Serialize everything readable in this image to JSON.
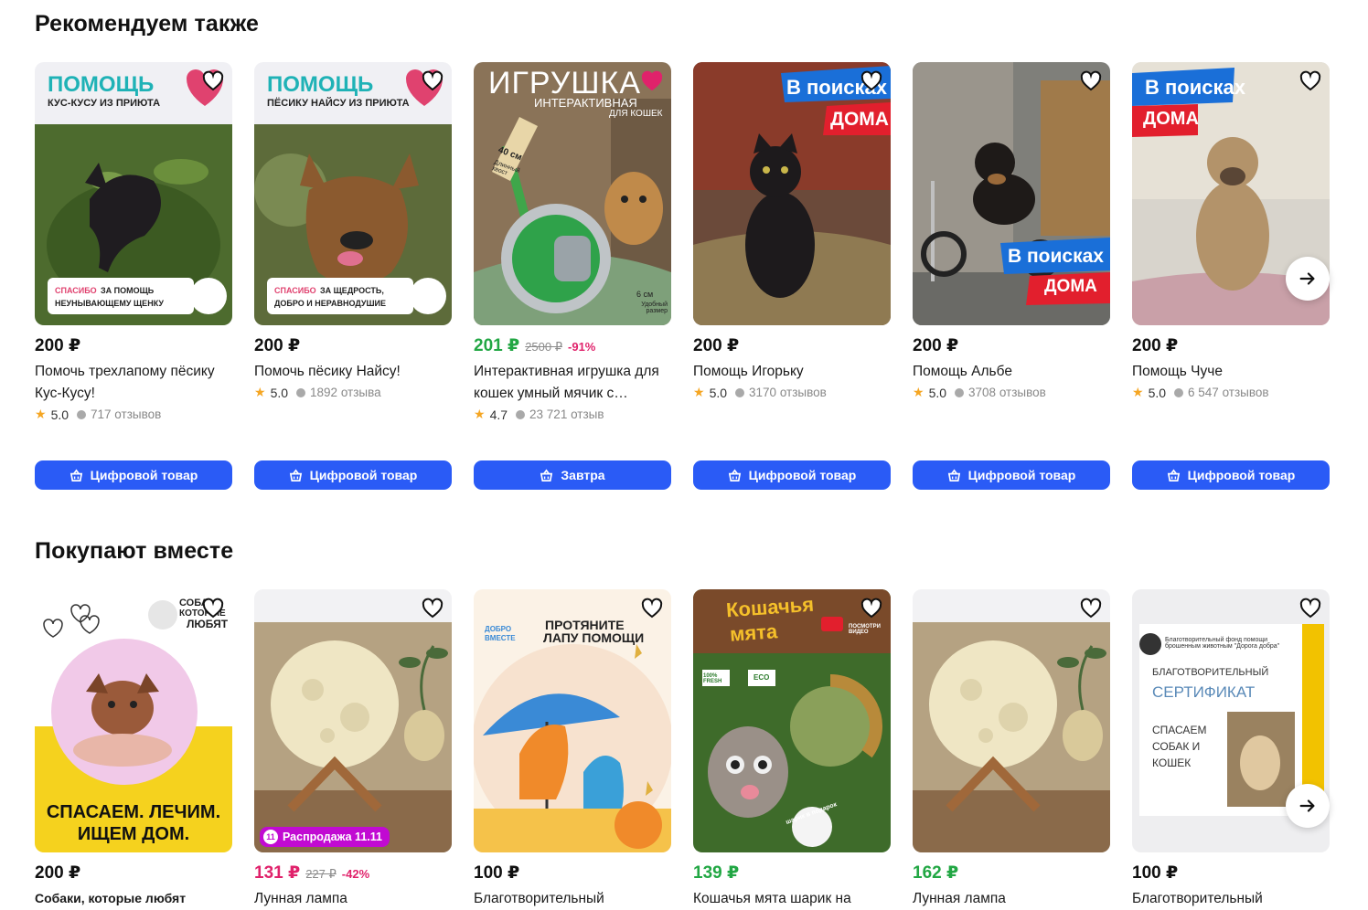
{
  "sections": {
    "recommended_title": "Рекомендуем также",
    "together_title": "Покупают вместе"
  },
  "recommended": [
    {
      "price": "200 ₽",
      "name": "Помочь трехлапому пёсику Кус-Кусу!",
      "rating": "5.0",
      "reviews": "717 отзывов",
      "button": "Цифровой товар",
      "overlay": [
        "ПОМОЩЬ",
        "КУС-КУСУ ИЗ ПРИЮТА",
        "СПАСИБО",
        "ЗА ПОМОЩЬ",
        "НЕУНЫВАЮЩЕМУ ЩЕНКУ"
      ]
    },
    {
      "price": "200 ₽",
      "name": "Помочь пёсику Найсу!",
      "rating": "5.0",
      "reviews": "1892 отзыва",
      "button": "Цифровой товар",
      "overlay": [
        "ПОМОЩЬ",
        "ПЁСИКУ НАЙСУ ИЗ ПРИЮТА",
        "СПАСИБО",
        "ЗА ЩЕДРОСТЬ,",
        "ДОБРО И НЕРАВНОДУШИЕ"
      ]
    },
    {
      "price": "201 ₽",
      "old_price": "2500 ₽",
      "discount": "-91%",
      "name": "Интерактивная игрушка для кошек умный мячик с…",
      "rating": "4.7",
      "reviews": "23 721 отзыв",
      "button": "Завтра",
      "overlay": [
        "ИГРУШКА",
        "ИНТЕРАКТИВНАЯ",
        "ДЛЯ КОШЕК",
        "40 см",
        "Длинный хвост",
        "6 см",
        "Удобный размер"
      ]
    },
    {
      "price": "200 ₽",
      "name": "Помощь Игорьку",
      "rating": "5.0",
      "reviews": "3170 отзывов",
      "button": "Цифровой товар",
      "overlay": [
        "В поисках",
        "ДОМА"
      ]
    },
    {
      "price": "200 ₽",
      "name": "Помощь Альбе",
      "rating": "5.0",
      "reviews": "3708 отзывов",
      "button": "Цифровой товар",
      "overlay": [
        "В поисках",
        "ДОМА"
      ]
    },
    {
      "price": "200 ₽",
      "name": "Помощь Чуче",
      "rating": "5.0",
      "reviews": "6 547 отзывов",
      "button": "Цифровой товар",
      "overlay": [
        "В поисках",
        "ДОМА"
      ]
    }
  ],
  "together": [
    {
      "price": "200 ₽",
      "name": "Собаки, которые любят",
      "overlay": [
        "СОБА",
        "КОТОРЫЕ",
        "ЛЮБЯТ",
        "СПАСАЕМ. ЛЕЧИМ.",
        "ИЩЕМ ДОМ."
      ]
    },
    {
      "price": "131 ₽",
      "old_price": "227 ₽",
      "discount": "-42%",
      "name": "Лунная лампа",
      "badge": "Распродажа 11.11"
    },
    {
      "price": "100 ₽",
      "name": "Благотворительный",
      "overlay": [
        "ДОБРО",
        "ВМЕСТЕ",
        "ПРОТЯНИТЕ",
        "ЛАПУ ПОМОЩИ"
      ]
    },
    {
      "price": "139 ₽",
      "name": "Кошачья мята шарик на",
      "overlay": [
        "Кошачья",
        "мята",
        "100% FRESH",
        "ECO",
        "ПОСМОТРИ ВИДЕО",
        "шарик в подарок"
      ]
    },
    {
      "price": "162 ₽",
      "name": "Лунная лампа"
    },
    {
      "price": "100 ₽",
      "name": "Благотворительный",
      "overlay": [
        "Благотворительный фонд помощи брошенным животным \"Дорога добра\"",
        "БЛАГОТВОРИТЕЛЬНЫЙ",
        "СЕРТИФИКАТ",
        "СПАСАЕМ",
        "СОБАК И",
        "КОШЕК"
      ]
    }
  ],
  "colors": {
    "accent_blue": "#2a5bf6",
    "price_green": "#22a744",
    "price_pink": "#e0226b",
    "sale_purple": "#c10ad2",
    "star": "#f5a623"
  },
  "icons": {
    "favorite": "heart-outline-icon",
    "favorite_active": "heart-filled-icon",
    "next": "arrow-right-icon",
    "cart": "basket-icon"
  }
}
